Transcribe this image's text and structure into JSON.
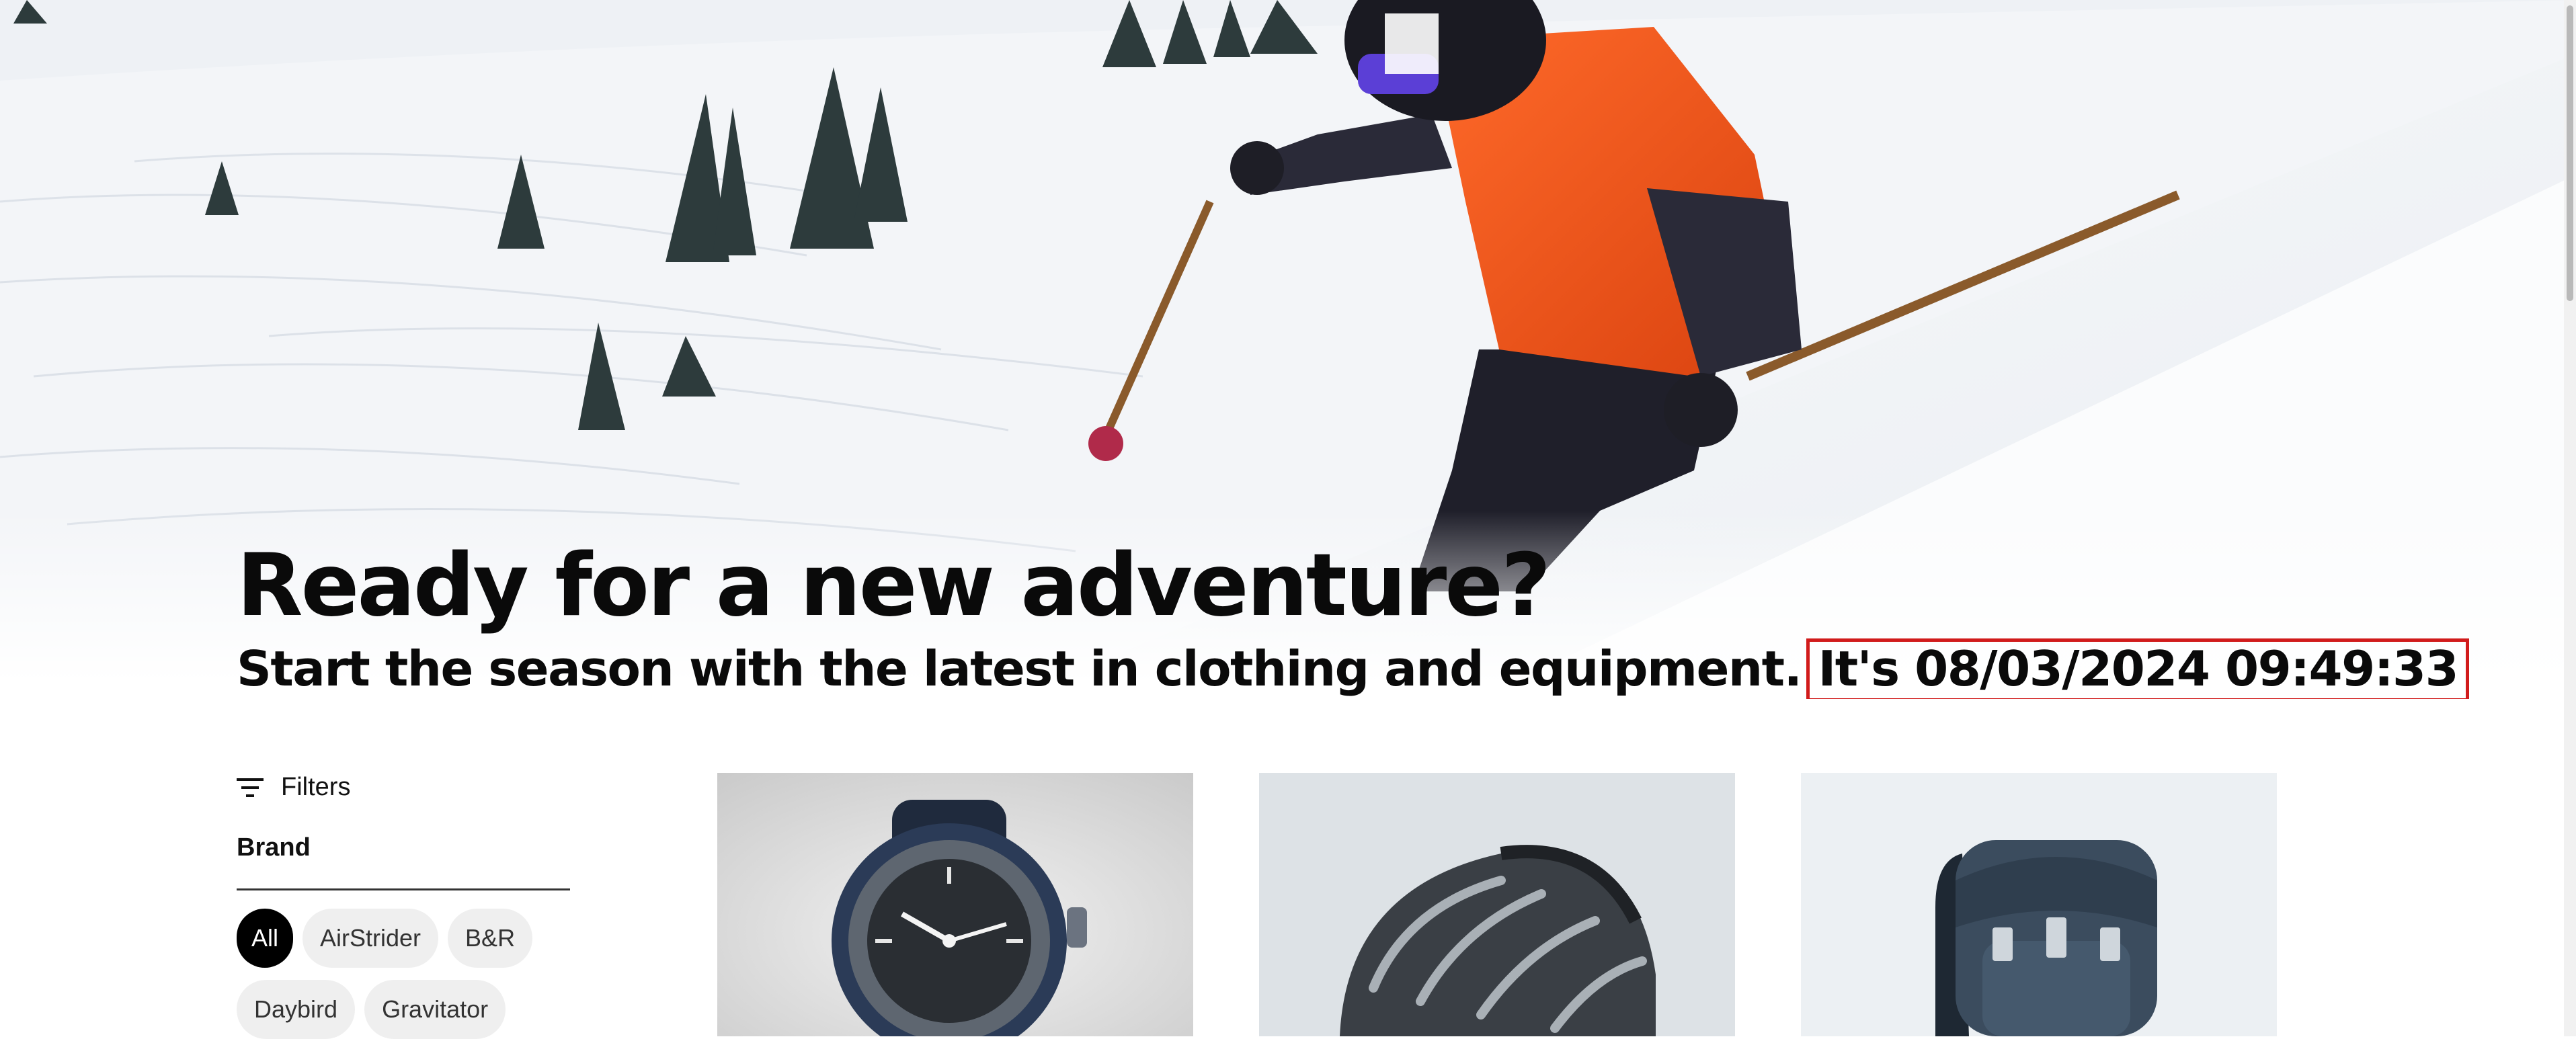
{
  "hero": {
    "title": "Ready for a new adventure?",
    "subtitle": "Start the season with the latest in clothing and equipment.",
    "clock": "It's 08/03/2024 09:49:33",
    "image": "skier-on-snowy-slope"
  },
  "filters": {
    "toggle_label": "Filters",
    "toggle_icon": "filter-lines-icon",
    "brand_heading": "Brand",
    "brands": [
      {
        "label": "All",
        "active": true
      },
      {
        "label": "AirStrider",
        "active": false
      },
      {
        "label": "B&R",
        "active": false
      },
      {
        "label": "Daybird",
        "active": false
      },
      {
        "label": "Gravitator",
        "active": false
      }
    ]
  },
  "products": [
    {
      "image": "smartwatch"
    },
    {
      "image": "bike-helmet"
    },
    {
      "image": "backpack"
    }
  ],
  "colors": {
    "clock_border": "#d11b1b",
    "active_chip_bg": "#000000",
    "chip_bg": "#efefef"
  }
}
